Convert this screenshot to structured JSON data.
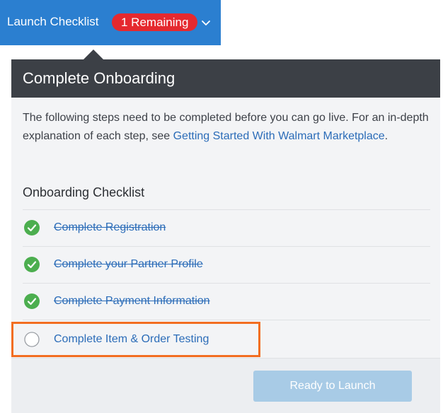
{
  "topbar": {
    "title": "Launch Checklist",
    "badge": "1 Remaining",
    "dropdown_icon": "chevron-down-icon",
    "background_color": "#2b7fd0",
    "badge_color": "#e5292f"
  },
  "panel": {
    "title": "Complete Onboarding",
    "intro_text": "The following steps need to be completed before you can go live. For an in-depth explanation of each step, see ",
    "intro_link": "Getting Started With Walmart Marketplace",
    "intro_end": ".",
    "checklist_heading": "Onboarding Checklist",
    "items": [
      {
        "label": "Complete Registration",
        "completed": true,
        "icon": "check-circle-icon"
      },
      {
        "label": "Complete your Partner Profile",
        "completed": true,
        "icon": "check-circle-icon"
      },
      {
        "label": "Complete Payment Information",
        "completed": true,
        "icon": "check-circle-icon"
      },
      {
        "label": "Complete Item & Order Testing",
        "completed": false,
        "highlighted": true,
        "icon": "empty-circle-icon"
      }
    ],
    "launch_button": "Ready to Launch",
    "launch_button_enabled": false
  },
  "colors": {
    "header_dark": "#3c4046",
    "link_blue": "#2b6cb8",
    "check_green": "#4cae4f",
    "highlight_orange": "#f26e21",
    "disabled_button": "#a8cbe6"
  }
}
